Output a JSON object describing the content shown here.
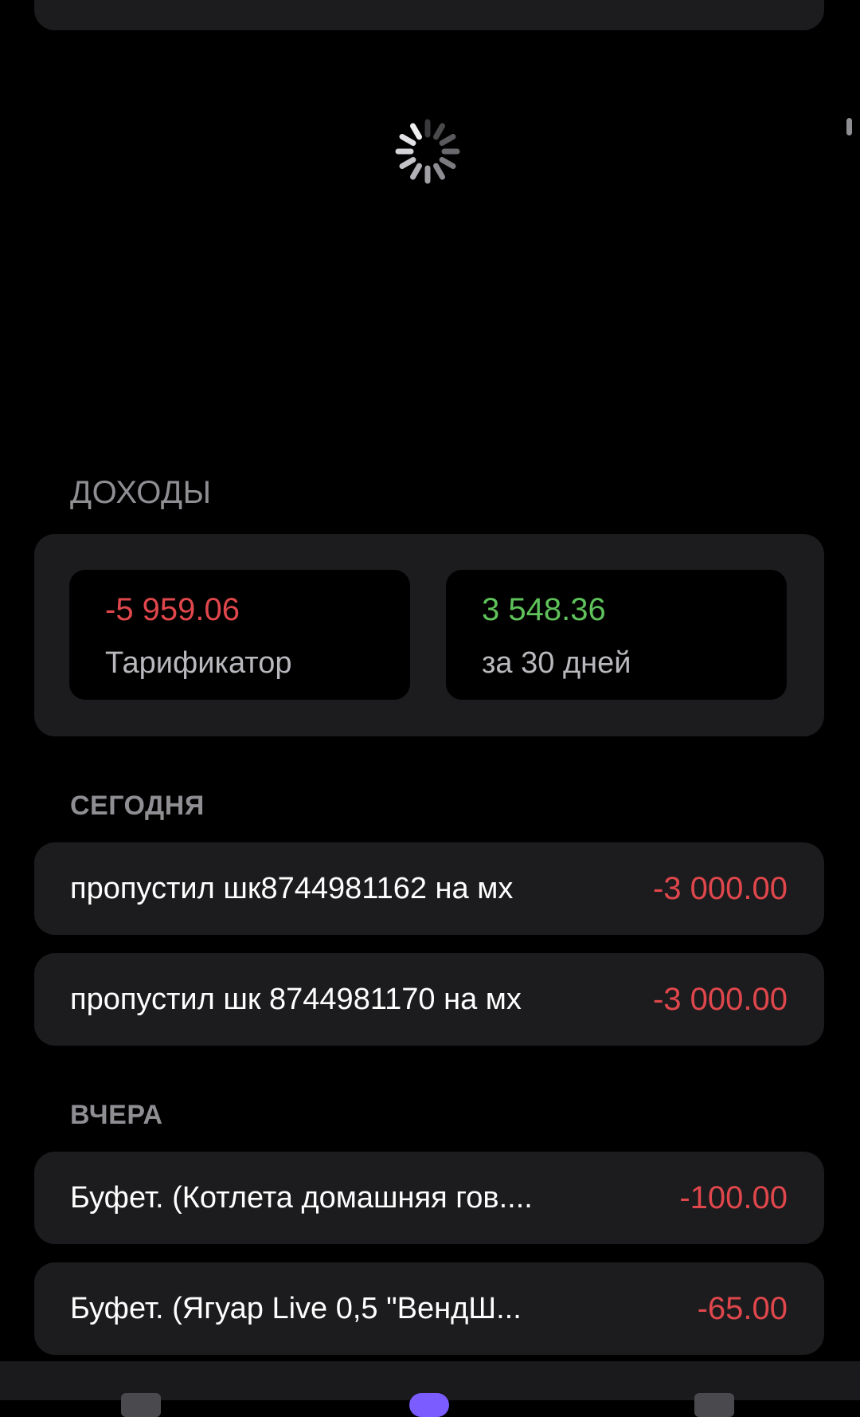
{
  "income_section": {
    "label": "ДОХОДЫ",
    "tiles": [
      {
        "value": "-5 959.06",
        "caption": "Тарификатор",
        "tone": "negative"
      },
      {
        "value": "3 548.36",
        "caption": "за 30 дней",
        "tone": "positive"
      }
    ]
  },
  "today": {
    "label": "СЕГОДНЯ",
    "items": [
      {
        "title": "пропустил шк8744981162 на мх",
        "amount": "-3 000.00"
      },
      {
        "title": "пропустил шк 8744981170 на мх",
        "amount": "-3 000.00"
      }
    ]
  },
  "yesterday": {
    "label": "ВЧЕРА",
    "items": [
      {
        "title": "Буфет. (Котлета домашняя гов....",
        "amount": "-100.00"
      },
      {
        "title": "Буфет. (Ягуар Live 0,5 \"ВендШ...",
        "amount": "-65.00"
      }
    ]
  },
  "colors": {
    "background": "#000000",
    "card": "#1c1c1e",
    "negative": "#e0474c",
    "positive": "#5fc25a",
    "label": "#8e8e93",
    "accent": "#7b5cff"
  },
  "icons": [
    "loading-spinner-icon",
    "tab-icon-left",
    "tab-icon-center",
    "tab-icon-right"
  ]
}
